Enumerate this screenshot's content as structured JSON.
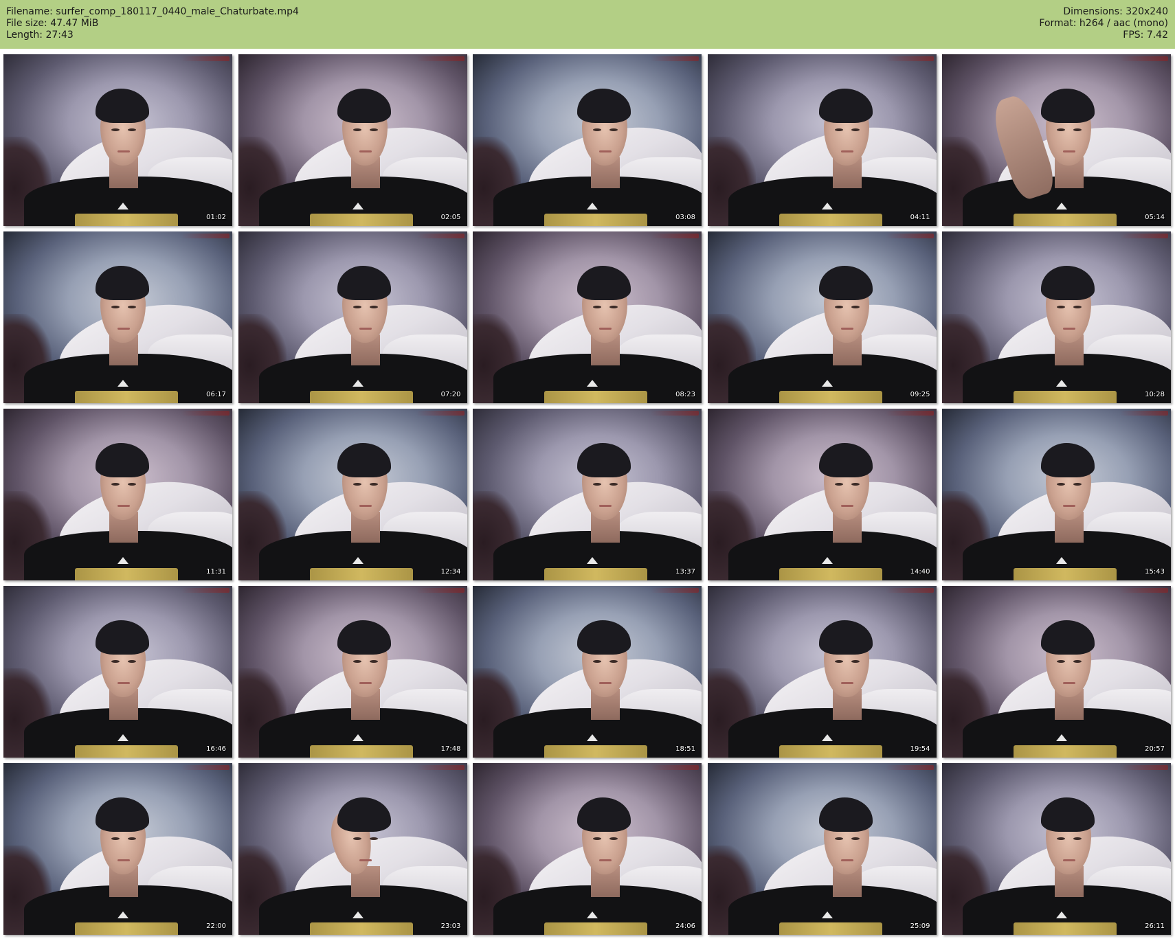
{
  "header": {
    "filename": "Filename: surfer_comp_180117_0440_male_Chaturbate.mp4",
    "file_size": "File size: 47.47 MiB",
    "length": "Length: 27:43",
    "dimensions": "Dimensions: 320x240",
    "format": "Format: h264 / aac (mono)",
    "fps": "FPS: 7.42"
  },
  "colors": {
    "header_background": "#b3cf85",
    "page_background": "#ffffff",
    "timestamp_text": "#ffffff"
  },
  "thumbnails": [
    {
      "timestamp": "01:02",
      "icon": "video-frame"
    },
    {
      "timestamp": "02:05",
      "icon": "video-frame"
    },
    {
      "timestamp": "03:08",
      "icon": "video-frame"
    },
    {
      "timestamp": "04:11",
      "icon": "video-frame"
    },
    {
      "timestamp": "05:14",
      "icon": "video-frame"
    },
    {
      "timestamp": "06:17",
      "icon": "video-frame"
    },
    {
      "timestamp": "07:20",
      "icon": "video-frame"
    },
    {
      "timestamp": "08:23",
      "icon": "video-frame"
    },
    {
      "timestamp": "09:25",
      "icon": "video-frame"
    },
    {
      "timestamp": "10:28",
      "icon": "video-frame"
    },
    {
      "timestamp": "11:31",
      "icon": "video-frame"
    },
    {
      "timestamp": "12:34",
      "icon": "video-frame"
    },
    {
      "timestamp": "13:37",
      "icon": "video-frame"
    },
    {
      "timestamp": "14:40",
      "icon": "video-frame"
    },
    {
      "timestamp": "15:43",
      "icon": "video-frame"
    },
    {
      "timestamp": "16:46",
      "icon": "video-frame"
    },
    {
      "timestamp": "17:48",
      "icon": "video-frame"
    },
    {
      "timestamp": "18:51",
      "icon": "video-frame"
    },
    {
      "timestamp": "19:54",
      "icon": "video-frame"
    },
    {
      "timestamp": "20:57",
      "icon": "video-frame"
    },
    {
      "timestamp": "22:00",
      "icon": "video-frame"
    },
    {
      "timestamp": "23:03",
      "icon": "video-frame"
    },
    {
      "timestamp": "24:06",
      "icon": "video-frame"
    },
    {
      "timestamp": "25:09",
      "icon": "video-frame"
    },
    {
      "timestamp": "26:11",
      "icon": "video-frame"
    }
  ]
}
